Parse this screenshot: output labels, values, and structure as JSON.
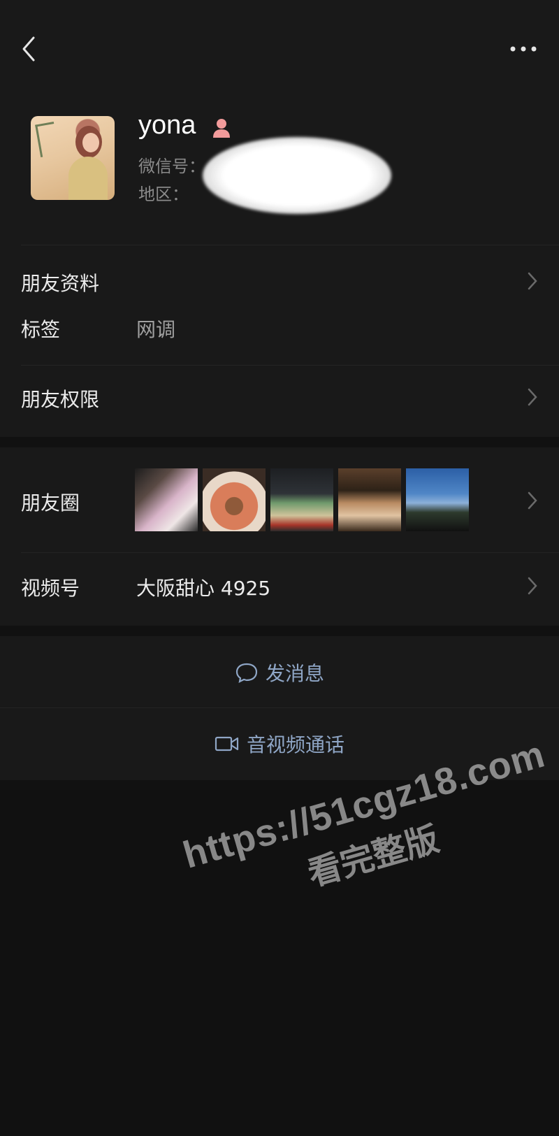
{
  "header": {
    "back_icon": "chevron-left-icon",
    "more_icon": "more-dots-icon"
  },
  "profile": {
    "nickname": "yona",
    "gender_icon": "female-person-icon",
    "wechat_id_label": "微信号：",
    "region_label": "地区：",
    "redaction": "white-blur-mask"
  },
  "friend_info": {
    "profile_label": "朋友资料",
    "tag_label": "标签",
    "tag_value": "网调",
    "permission_label": "朋友权限"
  },
  "moments": {
    "label": "朋友圈",
    "thumbnail_count": 5
  },
  "channels": {
    "label": "视频号",
    "value": "大阪甜心 4925"
  },
  "actions": {
    "message_label": "发消息",
    "message_icon": "chat-bubble-icon",
    "call_label": "音视频通话",
    "call_icon": "video-camera-icon"
  },
  "watermark": {
    "line1": "https://51cgz18.com",
    "line2": "看完整版"
  },
  "colors": {
    "background": "#111111",
    "card": "#191919",
    "link": "#8fa6c6",
    "gender": "#f29b9b"
  }
}
